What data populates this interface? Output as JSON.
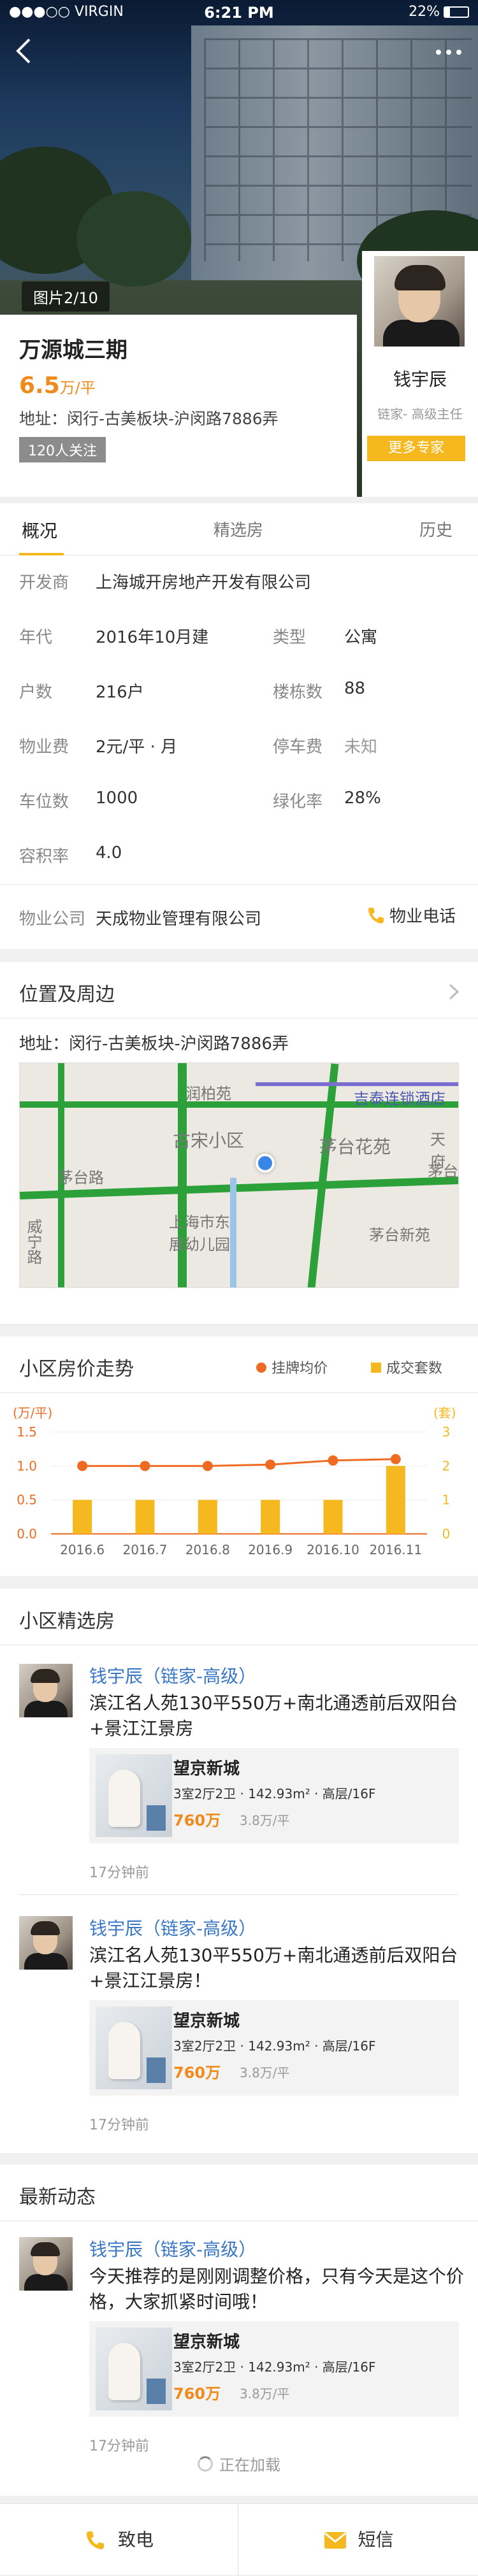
{
  "status_bar": {
    "carrier": "●●●○○ VIRGIN",
    "time": "6:21 PM",
    "battery": "22%"
  },
  "hero": {
    "photo_counter": "图片2/10"
  },
  "estate": {
    "name": "万源城三期",
    "price": "6.5",
    "price_unit": "万/平",
    "address": "地址：闵行-古美板块-沪闵路7886弄",
    "followers": "120人关注"
  },
  "agent": {
    "name": "钱宇辰",
    "title": "链家- 高级主任",
    "more_button": "更多专家"
  },
  "tabs": [
    {
      "label": "概况"
    },
    {
      "label": "精选房"
    },
    {
      "label": "历史"
    }
  ],
  "overview": {
    "developer_label": "开发商",
    "developer": "上海城开房地产开发有限公司",
    "year_label": "年代",
    "year": "2016年10月建",
    "type_label": "类型",
    "type": "公寓",
    "households_label": "户数",
    "households": "216户",
    "buildings_label": "楼栋数",
    "buildings": "88",
    "fee_label": "物业费",
    "fee": "2元/平 · 月",
    "parking_fee_label": "停车费",
    "parking_fee": "未知",
    "parking_label": "车位数",
    "parking": "1000",
    "green_label": "绿化率",
    "green": "28%",
    "ratio_label": "容积率",
    "ratio": "4.0",
    "property_label": "物业公司",
    "property": "天成物业管理有限公司",
    "phone_label": "物业电话"
  },
  "location": {
    "title": "位置及周边",
    "address": "地址：闵行-古美板块-沪闵路7886弄",
    "map_labels": {
      "runbaiyuan": "润柏苑",
      "store": "吉泰连锁酒店",
      "gusong": "古宋小区",
      "maotai_huayuan": "茅台花苑",
      "maotai_road": "茅台路",
      "maotai_road2": "茅台",
      "tianfu": "天府",
      "weining": "威宁路",
      "kindergarten": "上海市东\n展幼儿园",
      "maotai_xinyuan": "茅台新苑"
    }
  },
  "price_trend": {
    "title": "小区房价走势",
    "legend_price": "挂牌均价",
    "legend_deals": "成交套数",
    "left_unit": "(万/平)",
    "right_unit": "(套)"
  },
  "chart_data": {
    "type": "bar",
    "categories": [
      "2016.6",
      "2016.7",
      "2016.8",
      "2016.9",
      "2016.10",
      "2016.11"
    ],
    "series": [
      {
        "name": "挂牌均价",
        "type": "line",
        "axis": "left",
        "values": [
          1.0,
          1.0,
          1.0,
          1.02,
          1.08,
          1.1
        ],
        "color": "#f06b22"
      },
      {
        "name": "成交套数",
        "type": "bar",
        "axis": "right",
        "values": [
          1,
          1,
          1,
          1,
          1,
          2
        ],
        "color": "#f5b81e"
      }
    ],
    "left_axis": {
      "ylim": [
        0,
        1.5
      ],
      "ticks": [
        "0.0",
        "0.5",
        "1.0",
        "1.5"
      ]
    },
    "right_axis": {
      "ylim": [
        0,
        3
      ],
      "ticks": [
        "0",
        "1",
        "2",
        "3"
      ]
    },
    "grid": true
  },
  "featured": {
    "title": "小区精选房",
    "posts": [
      {
        "author": "钱宇辰",
        "tag": "（链家-高级）",
        "text": "滨江名人苑130平550万+南北通透前后双阳台+景江江景房",
        "house_name": "望京新城",
        "house_info": "3室2厅2卫 · 142.93m² · 高层/16F",
        "price": "760万",
        "unit_price": "3.8万/平",
        "time": "17分钟前"
      },
      {
        "author": "钱宇辰",
        "tag": "（链家-高级）",
        "text": "滨江名人苑130平550万+南北通透前后双阳台+景江江景房！",
        "house_name": "望京新城",
        "house_info": "3室2厅2卫 · 142.93m² · 高层/16F",
        "price": "760万",
        "unit_price": "3.8万/平",
        "time": "17分钟前"
      }
    ]
  },
  "news": {
    "title": "最新动态",
    "posts": [
      {
        "author": "钱宇辰",
        "tag": "（链家-高级）",
        "text": "今天推荐的是刚刚调整价格，只有今天是这个价格，大家抓紧时间哦！",
        "house_name": "望京新城",
        "house_info": "3室2厅2卫 · 142.93m² · 高层/16F",
        "price": "760万",
        "unit_price": "3.8万/平",
        "time": "17分钟前"
      }
    ],
    "loading": "正在加载"
  },
  "bottom_bar": {
    "call": "致电",
    "message": "短信"
  },
  "colors": {
    "accent": "#f5b81e",
    "link_blue": "#3a77c6",
    "price_orange": "#f08a1a"
  }
}
